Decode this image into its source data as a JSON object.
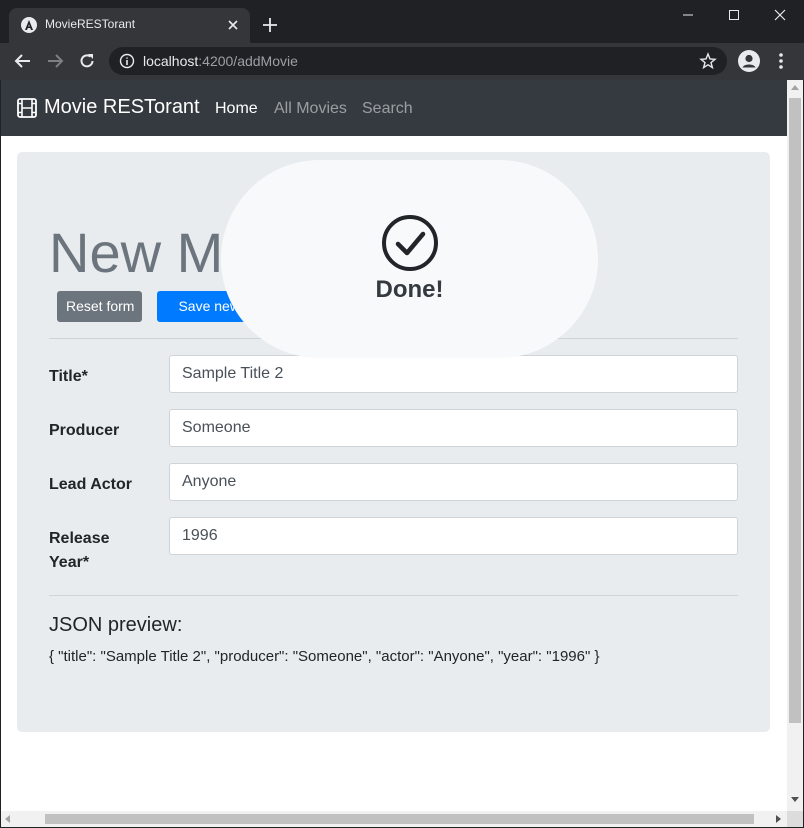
{
  "browser": {
    "tab_title": "MovieRESTorant",
    "url_host": "localhost",
    "url_path": ":4200/addMovie"
  },
  "app": {
    "brand": "Movie RESTorant",
    "nav": [
      {
        "label": "Home",
        "active": true
      },
      {
        "label": "All Movies",
        "active": false
      },
      {
        "label": "Search",
        "active": false
      }
    ]
  },
  "page": {
    "heading": "New Mo",
    "reset_label": "Reset form",
    "save_label": "Save new m",
    "fields": [
      {
        "label": "Title*",
        "value": "Sample Title 2"
      },
      {
        "label": "Producer",
        "value": "Someone"
      },
      {
        "label": "Lead Actor",
        "value": "Anyone"
      },
      {
        "label": "Release Year*",
        "value": "1996"
      }
    ],
    "json_heading": "JSON preview:",
    "json_preview": "{ \"title\": \"Sample Title 2\", \"producer\": \"Someone\", \"actor\": \"Anyone\", \"year\": \"1996\" }"
  },
  "toast": {
    "icon": "check-circle-icon",
    "message": "Done!"
  },
  "colors": {
    "navbar": "#343a40",
    "primary": "#007bff",
    "secondary": "#6c757d",
    "jumbotron": "#e9ecef"
  }
}
